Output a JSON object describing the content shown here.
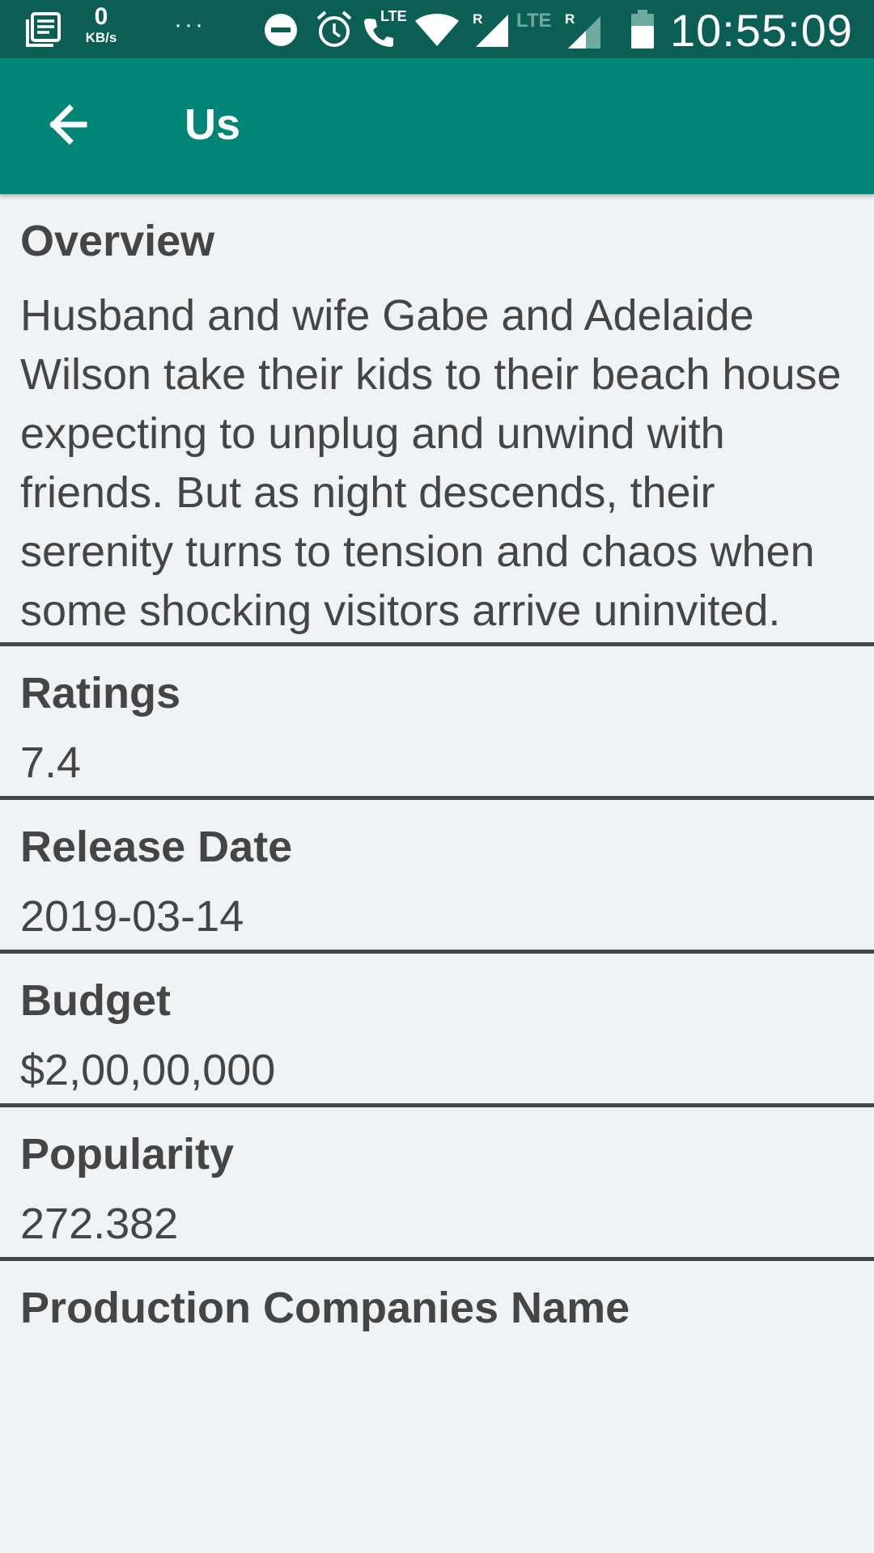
{
  "status_bar": {
    "net_speed_value": "0",
    "net_speed_unit": "KB/s",
    "more_dots": "···",
    "lte_label_1": "LTE",
    "roaming_1": "R",
    "lte_label_2": "LTE",
    "roaming_2": "R",
    "time": "10:55:09"
  },
  "app_bar": {
    "title": "Us",
    "back_icon": "arrow-back-icon"
  },
  "sections": {
    "overview": {
      "heading": "Overview",
      "text": "Husband and wife Gabe and Adelaide Wilson take their kids to their beach house expecting to unplug and unwind with friends. But as night descends, their serenity turns to tension and chaos when some shocking visitors arrive uninvited."
    },
    "ratings": {
      "heading": "Ratings",
      "value": "7.4"
    },
    "release_date": {
      "heading": "Release Date",
      "value": "2019-03-14"
    },
    "budget": {
      "heading": "Budget",
      "value": "$2,00,00,000"
    },
    "popularity": {
      "heading": "Popularity",
      "value": "272.382"
    },
    "production_companies": {
      "heading": "Production Companies Name"
    }
  },
  "colors": {
    "status_bar": "#0a5e53",
    "app_bar": "#008577",
    "background": "#f0f3f6",
    "text": "#454545"
  }
}
